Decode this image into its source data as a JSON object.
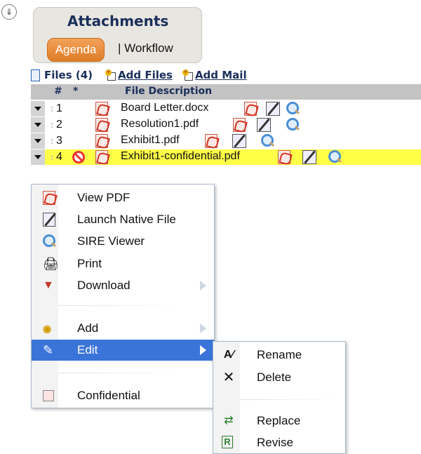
{
  "panel": {
    "toggle_icon": "double-chevron-down-icon",
    "title": "Attachments",
    "tabs": [
      "Agenda",
      "Workflow"
    ],
    "tab_separator": "|"
  },
  "files": {
    "label": "Files (4)",
    "add_files": "Add Files",
    "add_mail": "Add Mail"
  },
  "table": {
    "headers": [
      "#",
      "*",
      "File Description"
    ],
    "rows": [
      {
        "num": "1",
        "name": "Board Letter.docx"
      },
      {
        "num": "2",
        "name": "Resolution1.pdf"
      },
      {
        "num": "3",
        "name": "Exhibit1.pdf"
      },
      {
        "num": "4",
        "name": "Exhibit1-confidential.pdf",
        "highlight": "#ffff48",
        "status_icon": "no-entry-icon"
      }
    ]
  },
  "context_menu": {
    "items": [
      {
        "label": "View PDF",
        "icon": "pdf-icon"
      },
      {
        "label": "Launch Native File",
        "icon": "pencil-icon"
      },
      {
        "label": "SIRE Viewer",
        "icon": "magnifier-icon"
      },
      {
        "label": "Print",
        "icon": "printer-icon"
      },
      {
        "label": "Download",
        "icon": "download-icon",
        "submenu": true
      },
      {
        "label": "Add",
        "icon": "add-icon",
        "submenu": true
      },
      {
        "label": "Edit",
        "icon": "edit-icon",
        "submenu": true,
        "active": true
      },
      {
        "label": "Confidential",
        "icon": "confidential-icon"
      }
    ],
    "active_color": "#3b74d9"
  },
  "submenu": {
    "items": [
      {
        "label": "Rename",
        "icon": "rename-icon"
      },
      {
        "label": "Delete",
        "icon": "delete-x-icon"
      },
      {
        "label": "Replace",
        "icon": "replace-icon"
      },
      {
        "label": "Revise",
        "icon": "revise-icon"
      }
    ]
  }
}
